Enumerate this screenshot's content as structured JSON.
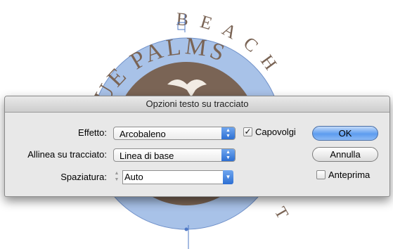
{
  "artwork": {
    "arc_text": "BLUE PALMS",
    "arc_text_outer": "BEACH",
    "outer_right_letters": "T",
    "colors": {
      "circle_fill": "#a8c2e8",
      "circle_stroke": "#6e8fc8",
      "brown": "#7a6455",
      "path_line": "#4f79c6"
    }
  },
  "dialog": {
    "title": "Opzioni testo su tracciato",
    "effect": {
      "label": "Effetto:",
      "value": "Arcobaleno"
    },
    "align": {
      "label": "Allinea su tracciato:",
      "value": "Linea di base"
    },
    "spacing": {
      "label": "Spaziatura:",
      "value": "Auto"
    },
    "flip": {
      "label": "Capovolgi",
      "checked": true
    },
    "preview": {
      "label": "Anteprima",
      "checked": false
    },
    "ok_label": "OK",
    "cancel_label": "Annulla"
  }
}
